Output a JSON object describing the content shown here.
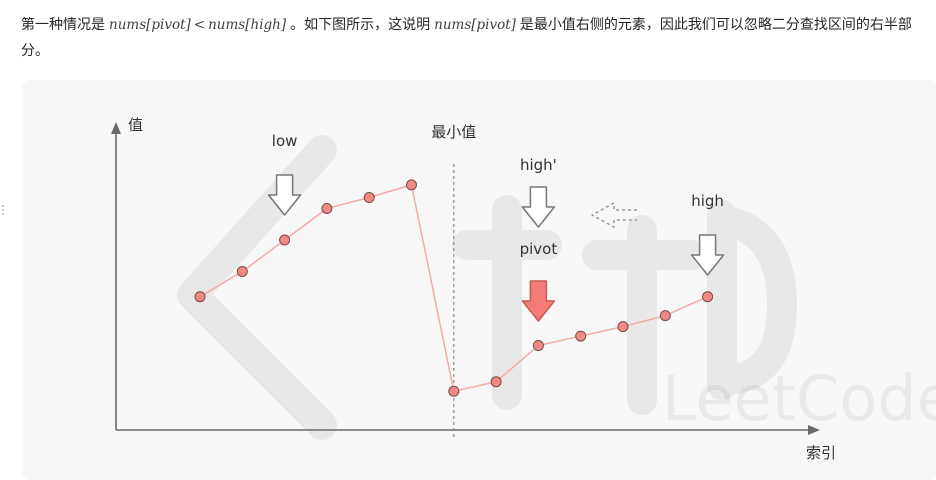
{
  "paragraph": {
    "t1": "第一种情况是",
    "m1_left": "nums[pivot]",
    "m1_op": "<",
    "m1_right": "nums[high]",
    "t2": "。如下图所示，这说明",
    "m2": "nums[pivot]",
    "t3": "是最小值右侧的元素，因此我们可以忽略二分查找区间的右半部分。"
  },
  "figure": {
    "y_axis_label": "值",
    "x_axis_label": "索引",
    "min_label": "最小值",
    "watermark_text": "LeetCode",
    "labels": {
      "low": "low",
      "high_prime": "high'",
      "pivot": "pivot",
      "high": "high"
    },
    "colors": {
      "point_fill": "#f08a85",
      "line": "#f6a9a5",
      "pivot_arrow": "#f47b77",
      "high_prime_text": "#f29b96",
      "axis": "#6a6a6a"
    },
    "icons": [
      "down-arrow-icon",
      "left-dashed-arrow-icon"
    ]
  },
  "chart_data": {
    "type": "line",
    "title": "",
    "xlabel": "索引",
    "ylabel": "值",
    "series": [
      {
        "values": [
          {
            "x": 0,
            "y": 4.2
          },
          {
            "x": 1,
            "y": 5.0
          },
          {
            "x": 2,
            "y": 6.0
          },
          {
            "x": 3,
            "y": 7.0
          },
          {
            "x": 4,
            "y": 7.35
          },
          {
            "x": 5,
            "y": 7.75
          },
          {
            "x": 6,
            "y": 1.2
          },
          {
            "x": 7,
            "y": 1.5
          },
          {
            "x": 8,
            "y": 2.65
          },
          {
            "x": 9,
            "y": 2.95
          },
          {
            "x": 10,
            "y": 3.25
          },
          {
            "x": 11,
            "y": 3.6
          },
          {
            "x": 12,
            "y": 4.2
          }
        ]
      }
    ],
    "annotations": [
      {
        "text": "low",
        "x": 2
      },
      {
        "text": "最小值",
        "x": 6
      },
      {
        "text": "high'",
        "x": 8
      },
      {
        "text": "pivot",
        "x": 8
      },
      {
        "text": "high",
        "x": 12
      }
    ],
    "grid": false
  }
}
